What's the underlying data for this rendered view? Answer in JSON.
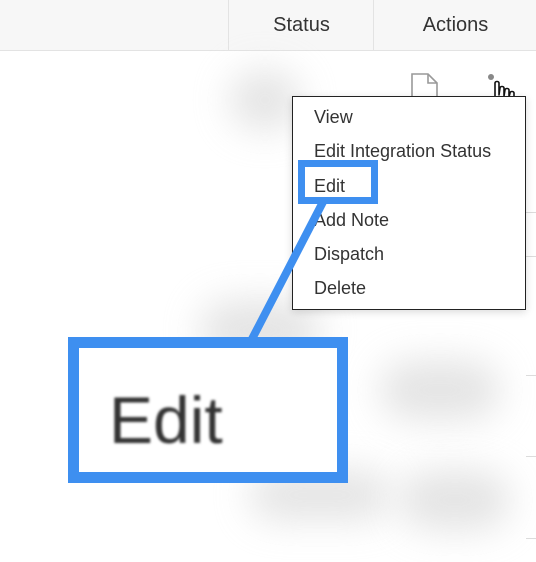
{
  "table": {
    "columns": {
      "status": "Status",
      "actions": "Actions"
    }
  },
  "row_actions": {
    "icons": [
      "document-icon",
      "kebab-menu-icon",
      "hand-cursor-icon"
    ]
  },
  "context_menu": {
    "items": [
      "View",
      "Edit Integration Status",
      "Edit",
      "Add Note",
      "Dispatch",
      "Delete"
    ]
  },
  "callout": {
    "highlighted_item": "Edit",
    "zoom_label": "Edit",
    "color": "#3e8ff0"
  }
}
